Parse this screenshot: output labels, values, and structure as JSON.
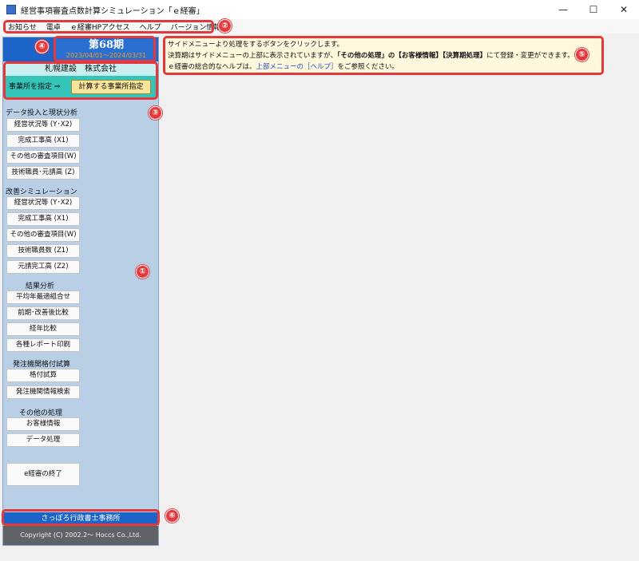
{
  "window": {
    "title": "経営事項審査点数計算シミュレーション「ｅ経審」",
    "minimize": "—",
    "maximize": "☐",
    "close": "✕"
  },
  "menu": [
    "お知らせ",
    "電卓",
    "ｅ経審HPアクセス",
    "ヘルプ",
    "バージョン情報"
  ],
  "badges": [
    "①",
    "②",
    "③",
    "④",
    "⑤",
    "⑥"
  ],
  "sidebar": {
    "period_title": "第68期",
    "period_range": "2023/04/01～2024/03/31",
    "company_name": "札幌建設　株式会社",
    "office_label": "事業所を指定 ⇒",
    "office_button": "計算する事業所指定",
    "sections": [
      {
        "title": "データ投入と現状分析",
        "buttons": [
          "経営状況等 (Y･X2)",
          "完成工事高 (X1)",
          "その他の審査項目(W)",
          "技術職員･元請高 (Z)"
        ]
      },
      {
        "title": "改善シミュレーション",
        "buttons": [
          "経営状況等 (Y･X2)",
          "完成工事高 (X1)",
          "その他の審査項目(W)",
          "技術職員数 (Z1)",
          "元請完工高 (Z2)"
        ]
      },
      {
        "title": "結果分析",
        "buttons": [
          "平均年最適組合せ",
          "前期･改善後比較",
          "経年比較",
          "各種レポート印刷"
        ]
      },
      {
        "title": "発注機関格付試算",
        "buttons": [
          "格付試算",
          "発注機関情報検索"
        ]
      },
      {
        "title": "その他の処理",
        "buttons": [
          "お客様情報",
          "データ処理"
        ]
      }
    ],
    "exit_button": "e経審の終了",
    "footer_office": "さっぽろ行政書士事務所",
    "copyright": "Copyright (C)  2002.2～ Hoccs Co.,Ltd."
  },
  "info": {
    "line1": "サイドメニューより処理をするボタンをクリックします。",
    "line2_a": "決算期はサイドメニューの上部に表示されていますが、",
    "line2_b": "「その他の処理」の【お客様情報】【決算期処理】",
    "line2_c": "にて登録・変更ができます。",
    "line3_a": "ｅ経審の総合的なヘルプは、",
    "line3_link": "上部メニューの［ヘルプ］",
    "line3_b": "をご参照ください。"
  }
}
